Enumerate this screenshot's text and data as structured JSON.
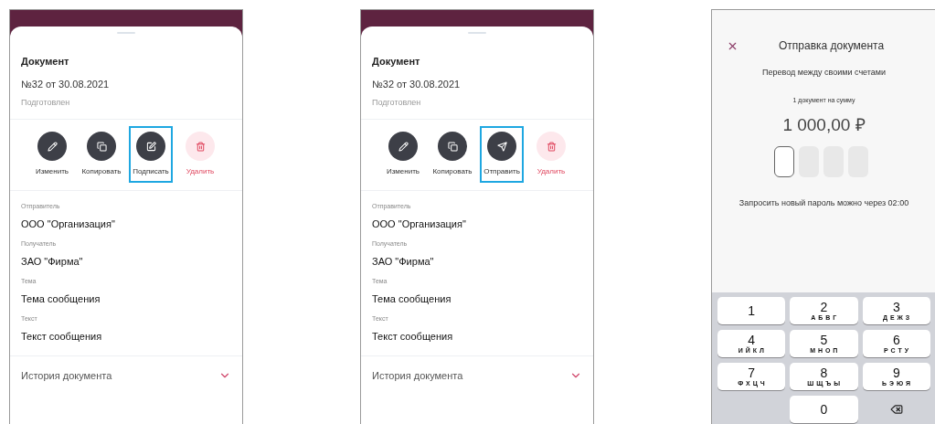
{
  "screens": [
    {
      "kind": "document",
      "title": "Документ",
      "number": "№32 от 30.08.2021",
      "status": "Подготовлен",
      "actions": [
        {
          "kind": "edit",
          "label": "Изменить",
          "highlighted": false
        },
        {
          "kind": "copy",
          "label": "Копировать",
          "highlighted": false
        },
        {
          "kind": "sign",
          "label": "Подписать",
          "highlighted": true
        },
        {
          "kind": "delete",
          "label": "Удалить",
          "highlighted": false
        }
      ],
      "fields": [
        {
          "label": "Отправитель",
          "value": "ООО \"Организация\""
        },
        {
          "label": "Получатель",
          "value": "ЗАО \"Фирма\""
        },
        {
          "label": "Тема",
          "value": "Тема сообщения"
        },
        {
          "label": "Текст",
          "value": "Текст сообщения"
        }
      ],
      "history": {
        "label": "История документа",
        "expanded": false
      }
    },
    {
      "kind": "document",
      "title": "Документ",
      "number": "№32 от 30.08.2021",
      "status": "Подготовлен",
      "actions": [
        {
          "kind": "edit",
          "label": "Изменить",
          "highlighted": false
        },
        {
          "kind": "copy",
          "label": "Копировать",
          "highlighted": false
        },
        {
          "kind": "send",
          "label": "Отправить",
          "highlighted": true
        },
        {
          "kind": "delete",
          "label": "Удалить",
          "highlighted": false
        }
      ],
      "fields": [
        {
          "label": "Отправитель",
          "value": "ООО \"Организация\""
        },
        {
          "label": "Получатель",
          "value": "ЗАО \"Фирма\""
        },
        {
          "label": "Тема",
          "value": "Тема сообщения"
        },
        {
          "label": "Текст",
          "value": "Текст сообщения"
        }
      ],
      "history": {
        "label": "История документа",
        "expanded": false
      }
    },
    {
      "kind": "otp",
      "title": "Отправка документа",
      "subtitle": "Перевод между своими счетами",
      "caption": "1 документ на сумму",
      "amount": "1 000,00 ₽",
      "pins": [
        {
          "selected": true
        },
        {
          "selected": false
        },
        {
          "selected": false
        },
        {
          "selected": false
        }
      ],
      "hint": "Запросить новый пароль можно через 02:00",
      "keys": [
        {
          "kind": "digit",
          "digit": "1"
        },
        {
          "kind": "digit",
          "digit": "2",
          "letters": "А Б В Г"
        },
        {
          "kind": "digit",
          "digit": "3",
          "letters": "Д Е Ж З"
        },
        {
          "kind": "digit",
          "digit": "4",
          "letters": "И Й К Л"
        },
        {
          "kind": "digit",
          "digit": "5",
          "letters": "М Н О П"
        },
        {
          "kind": "digit",
          "digit": "6",
          "letters": "Р С Т У"
        },
        {
          "kind": "digit",
          "digit": "7",
          "letters": "Ф Х Ц Ч"
        },
        {
          "kind": "digit",
          "digit": "8",
          "letters": "Ш Щ Ъ Ы"
        },
        {
          "kind": "digit",
          "digit": "9",
          "letters": "Ь Э Ю Я"
        },
        {
          "kind": "empty"
        },
        {
          "kind": "digit",
          "digit": "0"
        },
        {
          "kind": "backspace"
        }
      ]
    }
  ]
}
